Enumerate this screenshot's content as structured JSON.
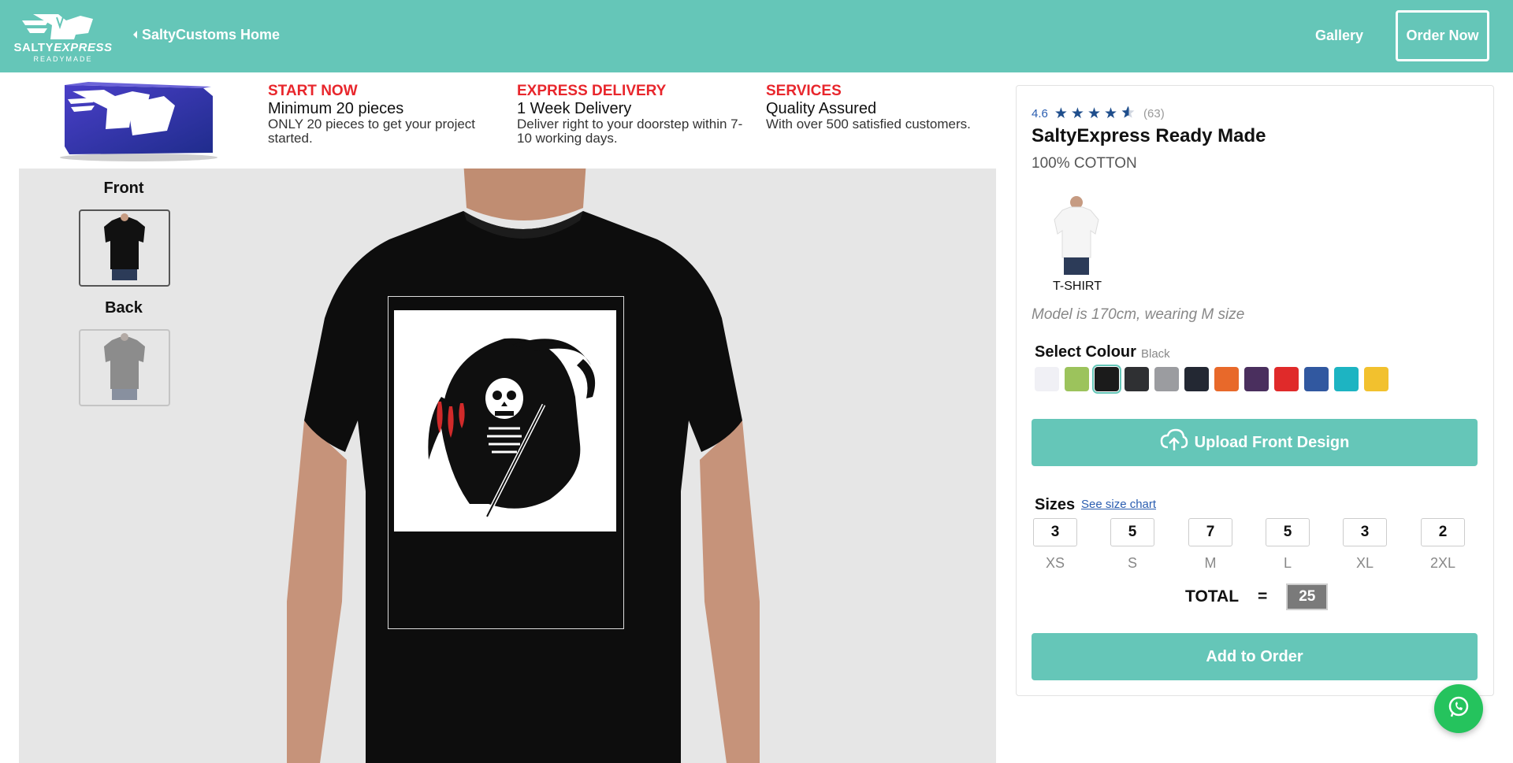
{
  "header": {
    "logo_name": "SALTY",
    "logo_name_italic": "EXPRESS",
    "logo_sub": "READYMADE",
    "home_link": "SaltyCustoms Home",
    "gallery": "Gallery",
    "order_now": "Order Now"
  },
  "info": [
    {
      "title": "START NOW",
      "headline": "Minimum 20 pieces",
      "desc": "ONLY 20 pieces to get your project started."
    },
    {
      "title": "EXPRESS DELIVERY",
      "headline": "1 Week Delivery",
      "desc": "Deliver right to your doorstep within 7-10 working days."
    },
    {
      "title": "SERVICES",
      "headline": "Quality Assured",
      "desc": "With over 500 satisfied customers."
    }
  ],
  "preview": {
    "views": [
      {
        "label": "Front",
        "active": true
      },
      {
        "label": "Back",
        "active": false
      }
    ]
  },
  "product": {
    "rating": "4.6",
    "review_count": "(63)",
    "title": "SaltyExpress Ready Made",
    "subtitle": "100% COTTON",
    "type_label": "T-SHIRT",
    "model_note": "Model is 170cm, wearing M size",
    "colour_title": "Select Colour",
    "colour_selected": "Black",
    "colours": [
      "#f0f0f5",
      "#9cc35c",
      "#1b1b1b",
      "#2f3033",
      "#9b9ca0",
      "#232833",
      "#e8692a",
      "#4a2f5e",
      "#e02a2a",
      "#3158a0",
      "#1db4c2",
      "#f2c12e"
    ],
    "selected_colour_index": 2,
    "upload_label": "Upload Front Design",
    "sizes_title": "Sizes",
    "size_chart_link": "See size chart",
    "sizes": [
      {
        "label": "XS",
        "qty": "3"
      },
      {
        "label": "S",
        "qty": "5"
      },
      {
        "label": "M",
        "qty": "7"
      },
      {
        "label": "L",
        "qty": "5"
      },
      {
        "label": "XL",
        "qty": "3"
      },
      {
        "label": "2XL",
        "qty": "2"
      }
    ],
    "total_label": "TOTAL",
    "total_eq": "=",
    "total_value": "25",
    "add_label": "Add to Order"
  }
}
